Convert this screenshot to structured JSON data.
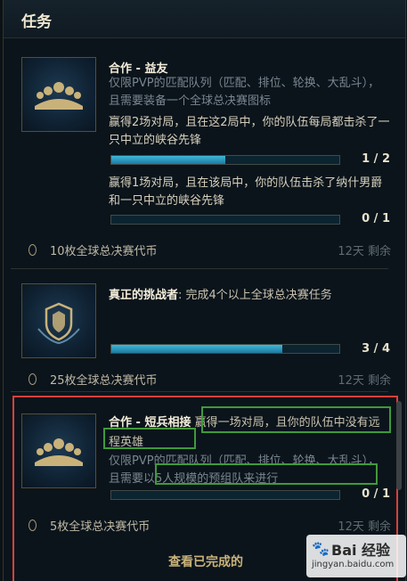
{
  "header": {
    "title": "任务"
  },
  "missions": [
    {
      "title": "合作 - 益友",
      "description": "仅限PVP的匹配队列（匹配、排位、轮换、大乱斗），且需要装备一个全球总决赛图标",
      "objectives": [
        {
          "text": "赢得2场对局，且在这2局中，你的队伍每局都击杀了一只中立的峡谷先锋",
          "progress": "1 / 2",
          "fraction": 0.5
        },
        {
          "text": "赢得1场对局，且在该局中，你的队伍击杀了纳什男爵和一只中立的峡谷先锋",
          "progress": "0 / 1",
          "fraction": 0
        }
      ],
      "reward": "10枚全球总决赛代币",
      "remaining": "12天 剩余",
      "icon": "team-icon"
    },
    {
      "title": "真正的挑战者",
      "title_suffix": ": 完成4个以上全球总决赛任务",
      "progress": "3 / 4",
      "fraction": 0.75,
      "reward": "25枚全球总决赛代币",
      "remaining": "12天 剩余",
      "icon": "worlds-crest-icon"
    },
    {
      "title": "合作 - 短兵相接",
      "title_suffix": "赢得一场对局，且你的队伍中没有远程英雄",
      "description": "仅限PVP的匹配队列（匹配、排位、轮换、大乱斗），且需要以5人规模的预组队来进行",
      "progress": "0 / 1",
      "fraction": 0,
      "reward": "5枚全球总决赛代币",
      "remaining": "12天 剩余",
      "icon": "team-icon"
    }
  ],
  "footer": {
    "link": "查看已完成的"
  },
  "watermark": {
    "line1": "Bai 经验",
    "line2": "jingyan.baidu.com"
  },
  "colors": {
    "progress": "#3fb7d8",
    "highlight_red": "#d9403b",
    "highlight_green": "#3f9a3b",
    "gold": "#c9b27a"
  }
}
